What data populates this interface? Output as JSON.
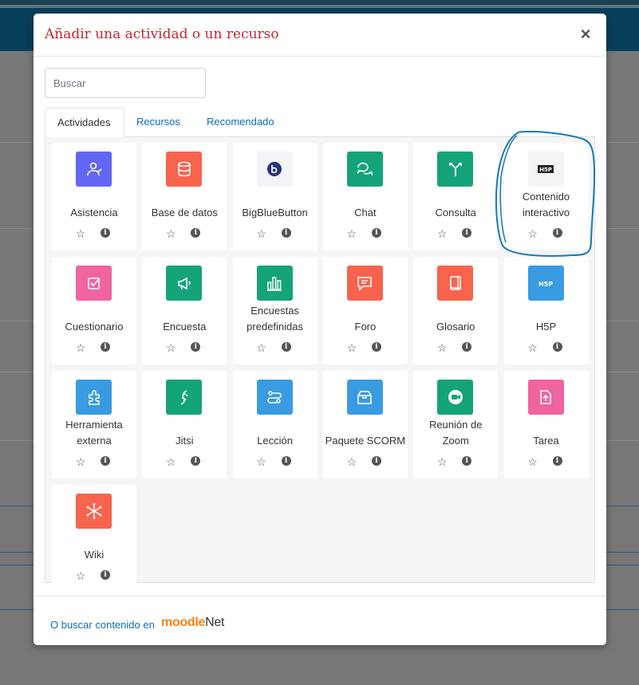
{
  "modal": {
    "title": "Añadir una actividad o un recurso",
    "close_label": "×",
    "search_placeholder": "Buscar",
    "tabs": [
      {
        "label": "Actividades",
        "active": true
      },
      {
        "label": "Recursos",
        "active": false
      },
      {
        "label": "Recomendado",
        "active": false
      }
    ],
    "footer": {
      "link_text": "O buscar contenido en",
      "logo_text_1": "moodle",
      "logo_text_2": "Net"
    }
  },
  "activities": [
    {
      "name": "Asistencia",
      "icon": "attendance-icon",
      "color": "#6366f1"
    },
    {
      "name": "Base de datos",
      "icon": "database-icon",
      "color": "#f7634d"
    },
    {
      "name": "BigBlueButton",
      "icon": "bigbluebutton-icon",
      "color": "#f2f4f7"
    },
    {
      "name": "Chat",
      "icon": "chat-icon",
      "color": "#15a37a"
    },
    {
      "name": "Consulta",
      "icon": "choice-icon",
      "color": "#15a37a"
    },
    {
      "name": "Contenido interactivo",
      "icon": "h5p-activity-icon",
      "color": "#f5f5f5"
    },
    {
      "name": "Cuestionario",
      "icon": "quiz-icon",
      "color": "#f0649f"
    },
    {
      "name": "Encuesta",
      "icon": "feedback-icon",
      "color": "#15a37a"
    },
    {
      "name": "Encuestas predefinidas",
      "icon": "survey-icon",
      "color": "#15a37a"
    },
    {
      "name": "Foro",
      "icon": "forum-icon",
      "color": "#f7634d"
    },
    {
      "name": "Glosario",
      "icon": "glossary-icon",
      "color": "#f7634d"
    },
    {
      "name": "H5P",
      "icon": "h5p-icon",
      "color": "#399be2"
    },
    {
      "name": "Herramienta externa",
      "icon": "lti-icon",
      "color": "#399be2"
    },
    {
      "name": "Jitsi",
      "icon": "jitsi-icon",
      "color": "#15a37a"
    },
    {
      "name": "Lección",
      "icon": "lesson-icon",
      "color": "#399be2"
    },
    {
      "name": "Paquete SCORM",
      "icon": "scorm-icon",
      "color": "#399be2"
    },
    {
      "name": "Reunión de Zoom",
      "icon": "zoom-icon",
      "color": "#15a37a"
    },
    {
      "name": "Tarea",
      "icon": "assignment-icon",
      "color": "#f0649f"
    },
    {
      "name": "Wiki",
      "icon": "wiki-icon",
      "color": "#f7634d"
    }
  ],
  "colors": {
    "title": "#c0282f",
    "link": "#0f6cbf",
    "annotation": "#1a7ab0"
  }
}
